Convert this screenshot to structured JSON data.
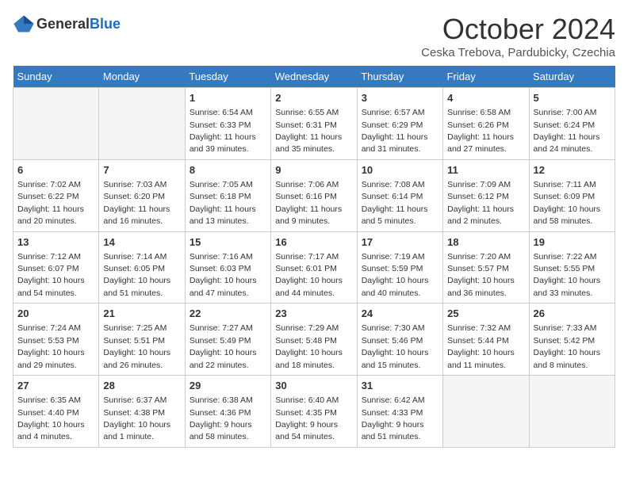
{
  "header": {
    "logo_general": "General",
    "logo_blue": "Blue",
    "month": "October 2024",
    "location": "Ceska Trebova, Pardubicky, Czechia"
  },
  "weekdays": [
    "Sunday",
    "Monday",
    "Tuesday",
    "Wednesday",
    "Thursday",
    "Friday",
    "Saturday"
  ],
  "weeks": [
    [
      {
        "day": "",
        "empty": true
      },
      {
        "day": "",
        "empty": true
      },
      {
        "day": "1",
        "sunrise": "Sunrise: 6:54 AM",
        "sunset": "Sunset: 6:33 PM",
        "daylight": "Daylight: 11 hours and 39 minutes."
      },
      {
        "day": "2",
        "sunrise": "Sunrise: 6:55 AM",
        "sunset": "Sunset: 6:31 PM",
        "daylight": "Daylight: 11 hours and 35 minutes."
      },
      {
        "day": "3",
        "sunrise": "Sunrise: 6:57 AM",
        "sunset": "Sunset: 6:29 PM",
        "daylight": "Daylight: 11 hours and 31 minutes."
      },
      {
        "day": "4",
        "sunrise": "Sunrise: 6:58 AM",
        "sunset": "Sunset: 6:26 PM",
        "daylight": "Daylight: 11 hours and 27 minutes."
      },
      {
        "day": "5",
        "sunrise": "Sunrise: 7:00 AM",
        "sunset": "Sunset: 6:24 PM",
        "daylight": "Daylight: 11 hours and 24 minutes."
      }
    ],
    [
      {
        "day": "6",
        "sunrise": "Sunrise: 7:02 AM",
        "sunset": "Sunset: 6:22 PM",
        "daylight": "Daylight: 11 hours and 20 minutes."
      },
      {
        "day": "7",
        "sunrise": "Sunrise: 7:03 AM",
        "sunset": "Sunset: 6:20 PM",
        "daylight": "Daylight: 11 hours and 16 minutes."
      },
      {
        "day": "8",
        "sunrise": "Sunrise: 7:05 AM",
        "sunset": "Sunset: 6:18 PM",
        "daylight": "Daylight: 11 hours and 13 minutes."
      },
      {
        "day": "9",
        "sunrise": "Sunrise: 7:06 AM",
        "sunset": "Sunset: 6:16 PM",
        "daylight": "Daylight: 11 hours and 9 minutes."
      },
      {
        "day": "10",
        "sunrise": "Sunrise: 7:08 AM",
        "sunset": "Sunset: 6:14 PM",
        "daylight": "Daylight: 11 hours and 5 minutes."
      },
      {
        "day": "11",
        "sunrise": "Sunrise: 7:09 AM",
        "sunset": "Sunset: 6:12 PM",
        "daylight": "Daylight: 11 hours and 2 minutes."
      },
      {
        "day": "12",
        "sunrise": "Sunrise: 7:11 AM",
        "sunset": "Sunset: 6:09 PM",
        "daylight": "Daylight: 10 hours and 58 minutes."
      }
    ],
    [
      {
        "day": "13",
        "sunrise": "Sunrise: 7:12 AM",
        "sunset": "Sunset: 6:07 PM",
        "daylight": "Daylight: 10 hours and 54 minutes."
      },
      {
        "day": "14",
        "sunrise": "Sunrise: 7:14 AM",
        "sunset": "Sunset: 6:05 PM",
        "daylight": "Daylight: 10 hours and 51 minutes."
      },
      {
        "day": "15",
        "sunrise": "Sunrise: 7:16 AM",
        "sunset": "Sunset: 6:03 PM",
        "daylight": "Daylight: 10 hours and 47 minutes."
      },
      {
        "day": "16",
        "sunrise": "Sunrise: 7:17 AM",
        "sunset": "Sunset: 6:01 PM",
        "daylight": "Daylight: 10 hours and 44 minutes."
      },
      {
        "day": "17",
        "sunrise": "Sunrise: 7:19 AM",
        "sunset": "Sunset: 5:59 PM",
        "daylight": "Daylight: 10 hours and 40 minutes."
      },
      {
        "day": "18",
        "sunrise": "Sunrise: 7:20 AM",
        "sunset": "Sunset: 5:57 PM",
        "daylight": "Daylight: 10 hours and 36 minutes."
      },
      {
        "day": "19",
        "sunrise": "Sunrise: 7:22 AM",
        "sunset": "Sunset: 5:55 PM",
        "daylight": "Daylight: 10 hours and 33 minutes."
      }
    ],
    [
      {
        "day": "20",
        "sunrise": "Sunrise: 7:24 AM",
        "sunset": "Sunset: 5:53 PM",
        "daylight": "Daylight: 10 hours and 29 minutes."
      },
      {
        "day": "21",
        "sunrise": "Sunrise: 7:25 AM",
        "sunset": "Sunset: 5:51 PM",
        "daylight": "Daylight: 10 hours and 26 minutes."
      },
      {
        "day": "22",
        "sunrise": "Sunrise: 7:27 AM",
        "sunset": "Sunset: 5:49 PM",
        "daylight": "Daylight: 10 hours and 22 minutes."
      },
      {
        "day": "23",
        "sunrise": "Sunrise: 7:29 AM",
        "sunset": "Sunset: 5:48 PM",
        "daylight": "Daylight: 10 hours and 18 minutes."
      },
      {
        "day": "24",
        "sunrise": "Sunrise: 7:30 AM",
        "sunset": "Sunset: 5:46 PM",
        "daylight": "Daylight: 10 hours and 15 minutes."
      },
      {
        "day": "25",
        "sunrise": "Sunrise: 7:32 AM",
        "sunset": "Sunset: 5:44 PM",
        "daylight": "Daylight: 10 hours and 11 minutes."
      },
      {
        "day": "26",
        "sunrise": "Sunrise: 7:33 AM",
        "sunset": "Sunset: 5:42 PM",
        "daylight": "Daylight: 10 hours and 8 minutes."
      }
    ],
    [
      {
        "day": "27",
        "sunrise": "Sunrise: 6:35 AM",
        "sunset": "Sunset: 4:40 PM",
        "daylight": "Daylight: 10 hours and 4 minutes."
      },
      {
        "day": "28",
        "sunrise": "Sunrise: 6:37 AM",
        "sunset": "Sunset: 4:38 PM",
        "daylight": "Daylight: 10 hours and 1 minute."
      },
      {
        "day": "29",
        "sunrise": "Sunrise: 6:38 AM",
        "sunset": "Sunset: 4:36 PM",
        "daylight": "Daylight: 9 hours and 58 minutes."
      },
      {
        "day": "30",
        "sunrise": "Sunrise: 6:40 AM",
        "sunset": "Sunset: 4:35 PM",
        "daylight": "Daylight: 9 hours and 54 minutes."
      },
      {
        "day": "31",
        "sunrise": "Sunrise: 6:42 AM",
        "sunset": "Sunset: 4:33 PM",
        "daylight": "Daylight: 9 hours and 51 minutes."
      },
      {
        "day": "",
        "empty": true
      },
      {
        "day": "",
        "empty": true
      }
    ]
  ]
}
